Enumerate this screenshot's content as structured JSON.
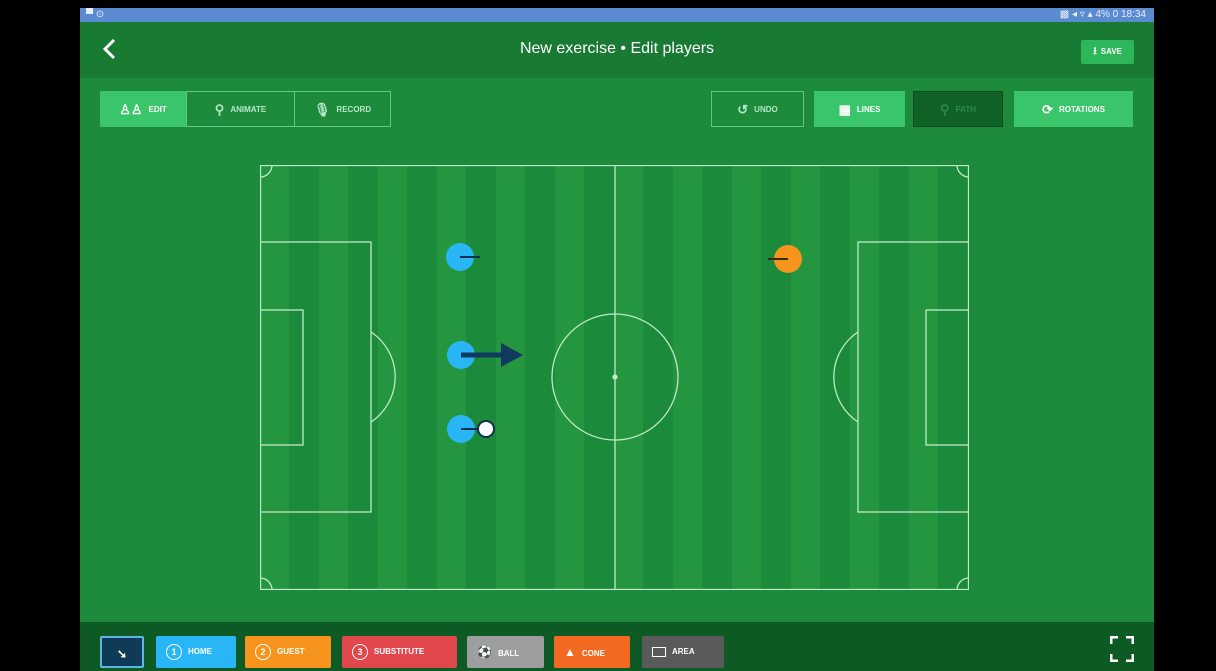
{
  "status_bar": {
    "left": "▀ ⊙",
    "right": "▩ ◂ ▿ ▴ 4% 0 18:34"
  },
  "header": {
    "back_icon": "chevron-left-icon",
    "title": "New exercise • Edit players",
    "save_label": "SAVE"
  },
  "toolbar": {
    "edit_label": "EDIT",
    "animate_label": "ANIMATE",
    "record_label": "RECORD",
    "undo_label": "UNDO",
    "lines_label": "LINES",
    "path_label": "PATH",
    "rotations_label": "ROTATIONS"
  },
  "palette": {
    "home_label": "HOME",
    "home_number": "1",
    "guest_label": "GUEST",
    "guest_number": "2",
    "substitute_label": "SUBSTITUTE",
    "substitute_number": "3",
    "ball_label": "BALL",
    "cone_label": "CONE",
    "area_label": "AREA",
    "fullscreen_icon": "fullscreen-icon"
  },
  "colors": {
    "home": "#29b6f6",
    "guest": "#f7941d",
    "substitute": "#e0484e",
    "ball": "#9e9e9e",
    "cone": "#f26a21",
    "area": "#5a5a5a",
    "accent": "#3bc56b",
    "pitch": "#1e8a3c"
  }
}
